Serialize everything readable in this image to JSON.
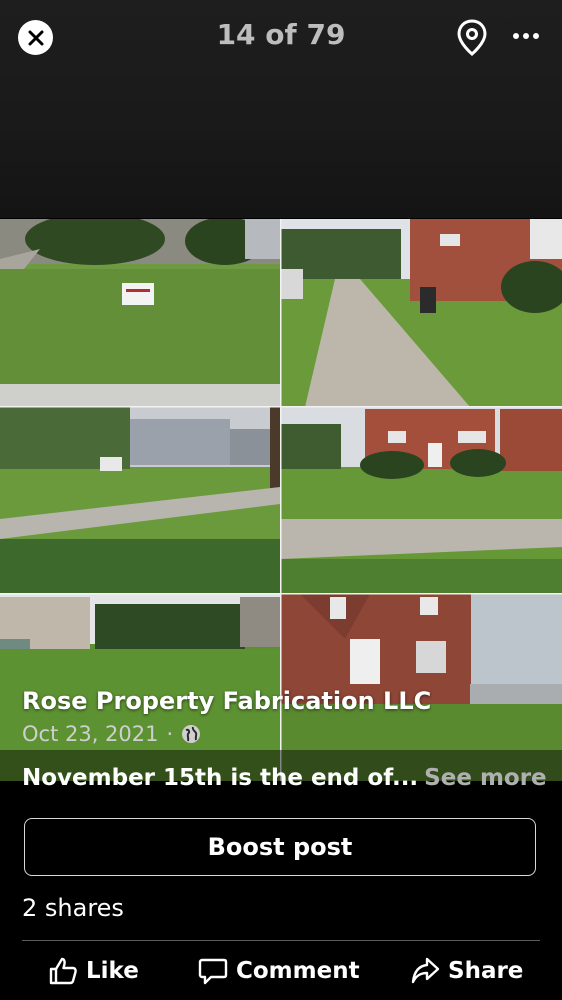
{
  "header": {
    "counter": "14 of 79",
    "close_icon": "close-icon",
    "location_icon": "map-pin-icon",
    "more_icon": "more-horizontal-icon"
  },
  "photo": {
    "subject": "collage-six-lawn-photos",
    "sign_text": "",
    "author": "Rose Property Fabrication LLC",
    "date": "Oct 23, 2021",
    "separator": "·",
    "audience_icon": "globe-icon"
  },
  "caption": {
    "text": "November 15th is the end of...",
    "see_more": "See more"
  },
  "actions": {
    "boost_label": "Boost post",
    "shares": "2 shares",
    "like_label": "Like",
    "comment_label": "Comment",
    "share_label": "Share"
  },
  "colors": {
    "background": "#000000",
    "grass": "#5a8a34",
    "brick": "#9a4a3a",
    "muted_text": "#bdbdbd"
  }
}
